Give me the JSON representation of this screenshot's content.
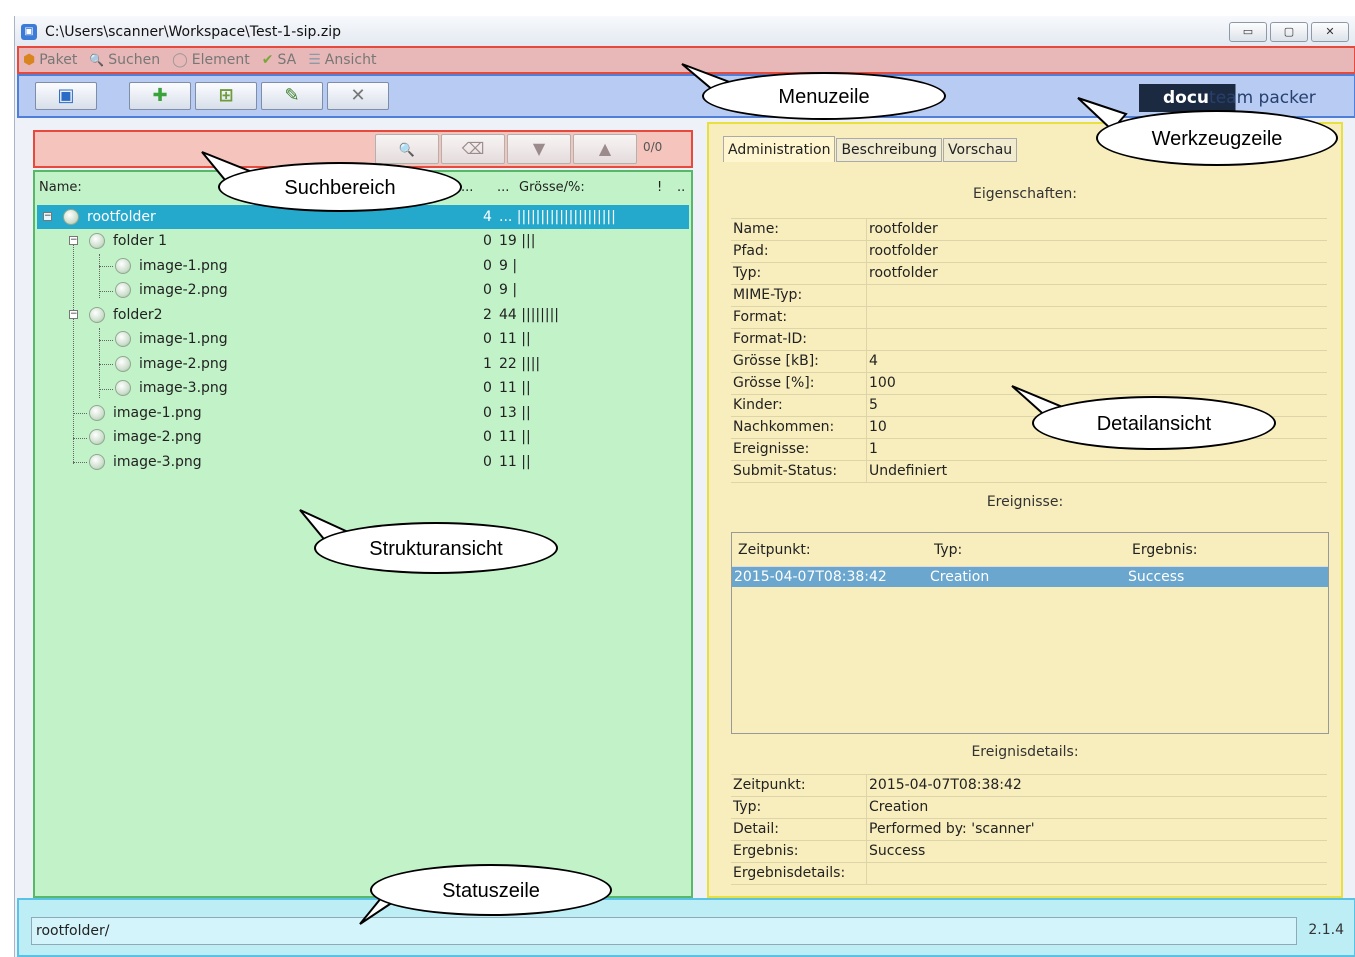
{
  "window": {
    "title": "C:\\Users\\scanner\\Workspace\\Test-1-sip.zip",
    "min_label": "▭",
    "max_label": "▢",
    "close_label": "✕"
  },
  "menu": [
    {
      "icon": "package-icon",
      "glyph": "⬢",
      "label": "Paket",
      "color": "#d8841f"
    },
    {
      "icon": "search-icon",
      "glyph": "🔍",
      "label": "Suchen",
      "color": "#8aa0c0"
    },
    {
      "icon": "element-icon",
      "glyph": "◯",
      "label": "Element",
      "color": "#999999"
    },
    {
      "icon": "check-icon",
      "glyph": "✔",
      "label": "SA",
      "color": "#79a83a"
    },
    {
      "icon": "list-icon",
      "glyph": "☰",
      "label": "Ansicht",
      "color": "#8a9aa8"
    }
  ],
  "toolbar": {
    "save_glyph": "▣",
    "add_glyph": "✚",
    "addfolder_glyph": "⊞",
    "edit_glyph": "✎",
    "delete_glyph": "✕",
    "logo_a": "docu",
    "logo_b": "team packer"
  },
  "search": {
    "search_glyph": "🔍",
    "clear_glyph": "⌫",
    "down_glyph": "▼",
    "up_glyph": "▲",
    "count": "0/0"
  },
  "tree": {
    "col_name": "Name:",
    "col_dots1": "...",
    "col_dots2": "...",
    "col_size": "Grösse/%:",
    "col_excl": "!",
    "col_dots3": "..",
    "rows": [
      {
        "name": "rootfolder",
        "num": "4",
        "size": "... |||||||||||||||||||||"
      },
      {
        "name": "folder 1",
        "num": "0",
        "size": "19 |||"
      },
      {
        "name": "image-1.png",
        "num": "0",
        "size": "9 |"
      },
      {
        "name": "image-2.png",
        "num": "0",
        "size": "9 |"
      },
      {
        "name": "folder2",
        "num": "2",
        "size": "44 ||||||||"
      },
      {
        "name": "image-1.png",
        "num": "0",
        "size": "11 ||"
      },
      {
        "name": "image-2.png",
        "num": "1",
        "size": "22 ||||"
      },
      {
        "name": "image-3.png",
        "num": "0",
        "size": "11 ||"
      },
      {
        "name": "image-1.png",
        "num": "0",
        "size": "13 ||"
      },
      {
        "name": "image-2.png",
        "num": "0",
        "size": "11 ||"
      },
      {
        "name": "image-3.png",
        "num": "0",
        "size": "11 ||"
      }
    ]
  },
  "detail": {
    "tabs": [
      "Administration",
      "Beschreibung",
      "Vorschau"
    ],
    "properties_title": "Eigenschaften:",
    "properties": [
      {
        "key": "Name:",
        "value": "rootfolder"
      },
      {
        "key": "Pfad:",
        "value": "rootfolder"
      },
      {
        "key": "Typ:",
        "value": "rootfolder"
      },
      {
        "key": "MIME-Typ:",
        "value": ""
      },
      {
        "key": "Format:",
        "value": ""
      },
      {
        "key": "Format-ID:",
        "value": ""
      },
      {
        "key": "Grösse [kB]:",
        "value": "4"
      },
      {
        "key": "Grösse [%]:",
        "value": "100"
      },
      {
        "key": "Kinder:",
        "value": "5"
      },
      {
        "key": "Nachkommen:",
        "value": "10"
      },
      {
        "key": "Ereignisse:",
        "value": "1"
      },
      {
        "key": "Submit-Status:",
        "value": "Undefiniert"
      }
    ],
    "events_title": "Ereignisse:",
    "events_head": [
      "Zeitpunkt:",
      "Typ:",
      "Ergebnis:"
    ],
    "events": [
      [
        "2015-04-07T08:38:42",
        "Creation",
        "Success"
      ]
    ],
    "eventdetails_title": "Ereignisdetails:",
    "eventdetails": [
      {
        "key": "Zeitpunkt:",
        "value": "2015-04-07T08:38:42"
      },
      {
        "key": "Typ:",
        "value": "Creation"
      },
      {
        "key": "Detail:",
        "value": "Performed by: 'scanner'"
      },
      {
        "key": "Ergebnis:",
        "value": "Success"
      },
      {
        "key": "Ergebnisdetails:",
        "value": ""
      }
    ]
  },
  "status": {
    "path": "rootfolder/",
    "version": "2.1.4"
  },
  "callouts": {
    "menu": "Menuzeile",
    "tools": "Werkzeugzeile",
    "search": "Suchbereich",
    "detail": "Detailansicht",
    "structure": "Strukturansicht",
    "status": "Statuszeile"
  }
}
